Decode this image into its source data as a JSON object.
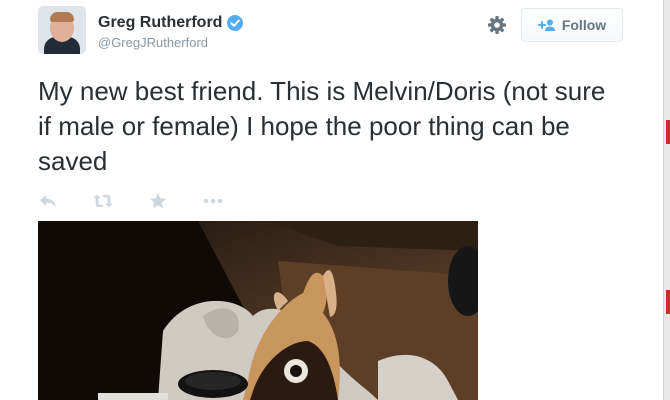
{
  "user": {
    "display_name": "Greg Rutherford",
    "handle": "@GregJRutherford",
    "verified": true
  },
  "header": {
    "follow_label": "Follow"
  },
  "tweet": {
    "text": "My new best friend. This is Melvin/Doris (not sure if male or female) I hope the poor thing can be saved"
  },
  "actions": {
    "icons": [
      "reply-icon",
      "retweet-icon",
      "favorite-icon",
      "more-icon"
    ]
  },
  "media": {
    "icon": "photo-dog"
  },
  "colors": {
    "verified_blue": "#55acee",
    "text": "#292f33",
    "muted": "#8899a6",
    "action_icon": "#ccd6dd"
  }
}
